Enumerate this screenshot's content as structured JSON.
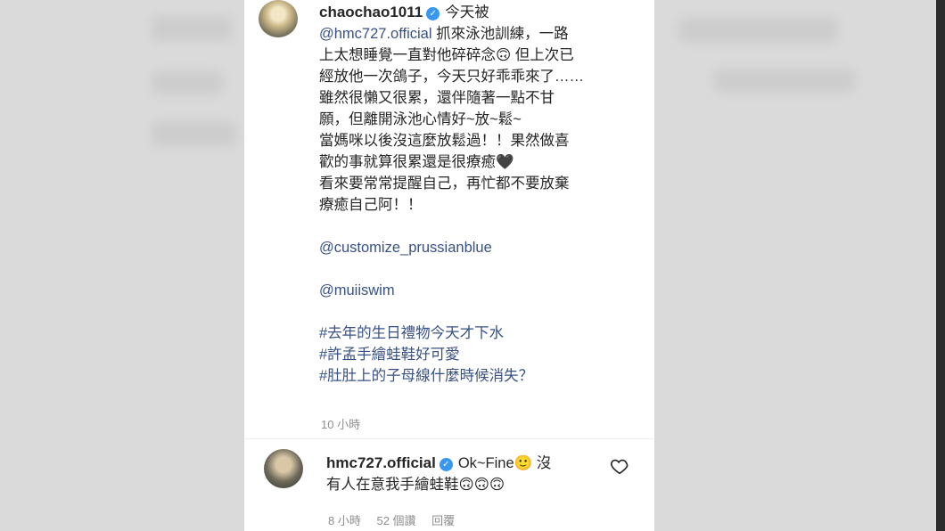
{
  "post": {
    "username": "chaochao1011",
    "lines": [
      {
        "lead": "今天被"
      },
      {
        "mention": "@hmc727.official",
        "text": " 抓來泳池訓練，一路"
      },
      {
        "text": "上太想睡覺一直對他碎碎念🙃 但上次已"
      },
      {
        "text": "經放他一次鴿子，今天只好乖乖來了……"
      },
      {
        "text": "雖然很懶又很累，還伴隨著一點不甘"
      },
      {
        "text": "願，但離開泳池心情好~放~鬆~"
      },
      {
        "text": "當媽咪以後沒這麼放鬆過！！果然做喜"
      },
      {
        "text": "歡的事就算很累還是很療癒🖤"
      },
      {
        "text": "看來要常常提醒自己，再忙都不要放棄"
      },
      {
        "text": "療癒自己阿！！"
      }
    ],
    "mention2": "@customize_prussianblue",
    "mention3": "@muiiswim",
    "hashtags": [
      "#去年的生日禮物今天才下水",
      "#許孟手繪蛙鞋好可愛",
      "#肚肚上的子母線什麼時候消失？"
    ],
    "time": "10 小時"
  },
  "reply": {
    "username": "hmc727.official",
    "text_line1": "Ok~Fine🙂 沒",
    "text_line2": "有人在意我手繪蛙鞋🙃🙃🙃",
    "time": "8 小時",
    "likes": "52 個讚",
    "reply_label": "回覆"
  },
  "icons": {
    "verified": "verified-badge-icon",
    "like": "heart-icon"
  },
  "colors": {
    "verified": "#3897f0",
    "mention": "#385185",
    "meta": "#8e8e8e"
  }
}
